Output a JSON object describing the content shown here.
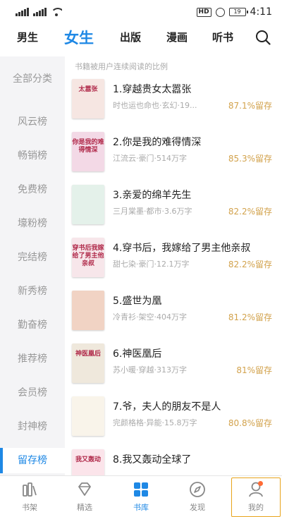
{
  "status_bar": {
    "network": "HD",
    "battery": "19",
    "time": "4:11"
  },
  "top_tabs": [
    {
      "label": "男生",
      "active": false
    },
    {
      "label": "女生",
      "active": true
    },
    {
      "label": "出版",
      "active": false
    },
    {
      "label": "漫画",
      "active": false
    },
    {
      "label": "听书",
      "active": false
    }
  ],
  "sidebar": {
    "items": [
      {
        "label": "全部分类",
        "active": false
      },
      {
        "label": "风云榜",
        "active": false
      },
      {
        "label": "畅销榜",
        "active": false
      },
      {
        "label": "免费榜",
        "active": false
      },
      {
        "label": "壕粉榜",
        "active": false
      },
      {
        "label": "完结榜",
        "active": false
      },
      {
        "label": "新秀榜",
        "active": false
      },
      {
        "label": "勤奋榜",
        "active": false
      },
      {
        "label": "推荐榜",
        "active": false
      },
      {
        "label": "会员榜",
        "active": false
      },
      {
        "label": "封神榜",
        "active": false
      },
      {
        "label": "留存榜",
        "active": true
      }
    ]
  },
  "main": {
    "caption": "书籍被用户连续阅读的比例",
    "books": [
      {
        "title": "1.穿越贵女太嚣张",
        "meta": "时也运也命也·玄幻·19...",
        "rate": "87.1%留存",
        "cover_bg": "#f6e6e2",
        "cover_text": "太嚣张"
      },
      {
        "title": "2.你是我的难得情深",
        "meta": "江流云·豪门·514万字",
        "rate": "85.3%留存",
        "cover_bg": "#f3d9e6",
        "cover_text": "你是我的难得情深"
      },
      {
        "title": "3.亲爱的绵羊先生",
        "meta": "三月棠墨·都市·3.6万字",
        "rate": "82.2%留存",
        "cover_bg": "#e4f1ea",
        "cover_text": ""
      },
      {
        "title": "4.穿书后，我嫁给了男主他亲叔",
        "meta": "甜七染·豪门·12.1万字",
        "rate": "82.2%留存",
        "cover_bg": "#f7e6ea",
        "cover_text": "穿书后我嫁给了男主他亲叔"
      },
      {
        "title": "5.盛世为凰",
        "meta": "冷青衫·架空·404万字",
        "rate": "81.2%留存",
        "cover_bg": "#f1d3c4",
        "cover_text": ""
      },
      {
        "title": "6.神医凰后",
        "meta": "苏小暖·穿越·313万字",
        "rate": "81%留存",
        "cover_bg": "#efe8dc",
        "cover_text": "神医凰后"
      },
      {
        "title": "7.爷，夫人的朋友不是人",
        "meta": "完颜格格·异能·15.8万字",
        "rate": "80.8%留存",
        "cover_bg": "#f9f4ea",
        "cover_text": ""
      },
      {
        "title": "8.我又轰动全球了",
        "meta": "",
        "rate": "",
        "cover_bg": "#fbe4ea",
        "cover_text": "我又轰动"
      }
    ]
  },
  "bottom_nav": [
    {
      "label": "书架",
      "icon": "bookshelf-icon",
      "active": false
    },
    {
      "label": "精选",
      "icon": "diamond-icon",
      "active": false
    },
    {
      "label": "书库",
      "icon": "grid-icon",
      "active": true
    },
    {
      "label": "发现",
      "icon": "compass-icon",
      "active": false
    },
    {
      "label": "我的",
      "icon": "user-icon",
      "active": false
    }
  ],
  "colors": {
    "accent": "#1e88e5",
    "retention": "#d2a24c",
    "muted": "#aaaaaa"
  }
}
